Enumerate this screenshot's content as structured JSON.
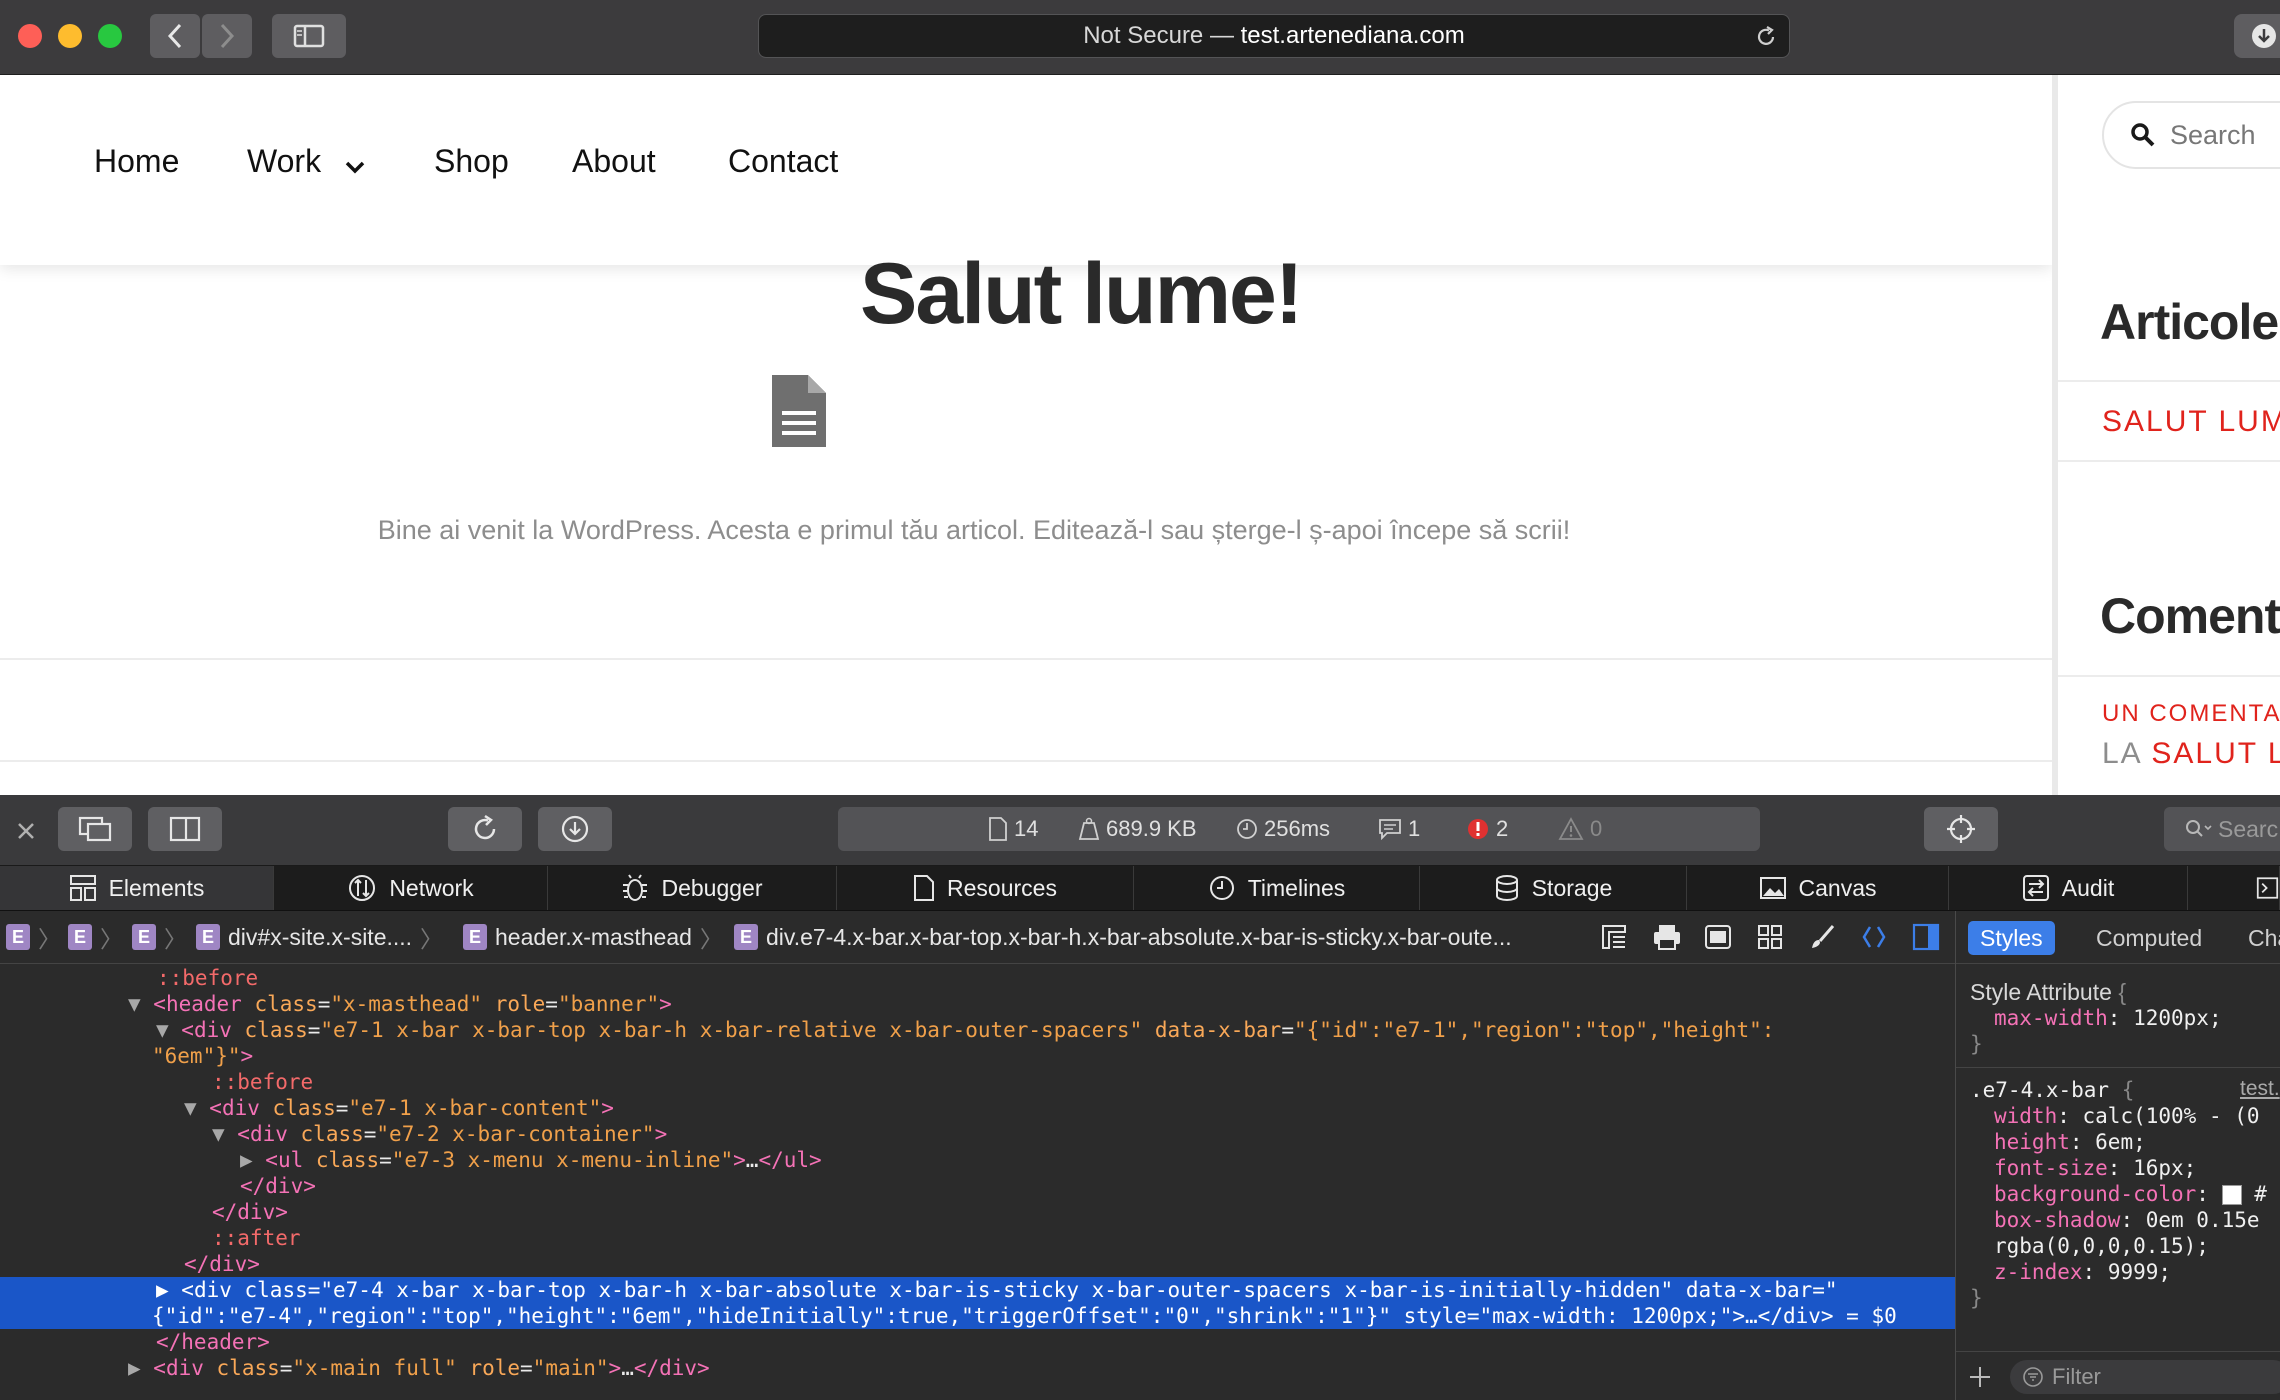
{
  "browser": {
    "url_prefix": "Not Secure — ",
    "url_host": "test.artenediana.com"
  },
  "site": {
    "menu": [
      {
        "label": "Home"
      },
      {
        "label": "Work",
        "has_submenu": true
      },
      {
        "label": "Shop"
      },
      {
        "label": "About"
      },
      {
        "label": "Contact"
      }
    ],
    "post_title": "Salut lume!",
    "post_excerpt": "Bine ai venit la WordPress. Acesta e primul tău articol. Editează-l sau șterge-l ș-apoi începe să scrii!",
    "sidebar": {
      "search_placeholder": "Search",
      "recent_heading": "Articole r",
      "recent_link": "SALUT LUME",
      "comments_heading": "Comenta",
      "comment_line1": "UN COMENTATO",
      "comment_prefix": "LA ",
      "comment_link": "SALUT LU"
    },
    "accent_color": "#e0231c"
  },
  "devtools": {
    "metrics": {
      "resources": "14",
      "size": "689.9 KB",
      "time": "256ms",
      "logs": "1",
      "errors": "2",
      "warnings": "0"
    },
    "search_placeholder": "Searc",
    "tabs": [
      {
        "label": "Elements",
        "icon": "elements-icon"
      },
      {
        "label": "Network",
        "icon": "network-icon"
      },
      {
        "label": "Debugger",
        "icon": "debugger-icon"
      },
      {
        "label": "Resources",
        "icon": "resources-icon"
      },
      {
        "label": "Timelines",
        "icon": "timelines-icon"
      },
      {
        "label": "Storage",
        "icon": "storage-icon"
      },
      {
        "label": "Canvas",
        "icon": "canvas-icon"
      },
      {
        "label": "Audit",
        "icon": "audit-icon"
      }
    ],
    "breadcrumbs": {
      "badge": "E",
      "items": [
        "div#x-site.x-site....",
        "header.x-masthead",
        "div.e7-4.x-bar.x-bar-top.x-bar-h.x-bar-absolute.x-bar-is-sticky.x-bar-oute..."
      ]
    },
    "dom": {
      "l1": "::before",
      "l2_tag": "header",
      "l2_attrs": [
        [
          "class",
          "\"x-masthead\""
        ],
        [
          "role",
          "\"banner\""
        ]
      ],
      "l3a": "<div",
      "l3_class_name": "class",
      "l3_class_val": "\"e7-1 x-bar x-bar-top x-bar-h x-bar-relative x-bar-outer-spacers\"",
      "l3_data_name": "data-x-bar",
      "l3_data_val": "\"{\"id\":\"e7-1\",\"region\":\"top\",\"height\":",
      "l4": "\"6em\"}\"",
      "l5": "::before",
      "l6_val": "\"e7-1 x-bar-content\"",
      "l7_val": "\"e7-2 x-bar-container\"",
      "l8_val": "\"e7-3 x-menu x-menu-inline\"",
      "l11": "::after",
      "sel_class_val": "\"e7-4 x-bar x-bar-top x-bar-h x-bar-absolute x-bar-is-sticky x-bar-outer-spacers x-bar-is-initially-hidden\"",
      "sel_data_name": "data-x-bar",
      "sel_line2": "{\"id\":\"e7-4\",\"region\":\"top\",\"height\":\"6em\",\"hideInitially\":true,\"triggerOffset\":\"0\",\"shrink\":\"1\"}\" style=\"max-width: 1200px;\">…</div> = $0",
      "main_val": "\"x-main full\"",
      "main_role": "\"main\""
    },
    "styles": {
      "tabs": [
        "Styles",
        "Computed",
        "Cha"
      ],
      "style_attr_header": "Style Attribute",
      "style_attr_prop": "max-width",
      "style_attr_val": "1200px",
      "rule_selector": ".e7-4.x-bar",
      "rule_source": "test.",
      "props": [
        {
          "name": "width",
          "value": "calc(100% - (0"
        },
        {
          "name": "height",
          "value": "6em"
        },
        {
          "name": "font-size",
          "value": "16px"
        },
        {
          "name": "background-color",
          "value": "#"
        },
        {
          "name": "box-shadow",
          "value": "0em 0.15e"
        }
      ],
      "box_shadow_cont": "rgba(0,0,0,0.15)",
      "z_index_name": "z-index",
      "z_index_value": "9999",
      "filter_placeholder": "Filter"
    }
  }
}
